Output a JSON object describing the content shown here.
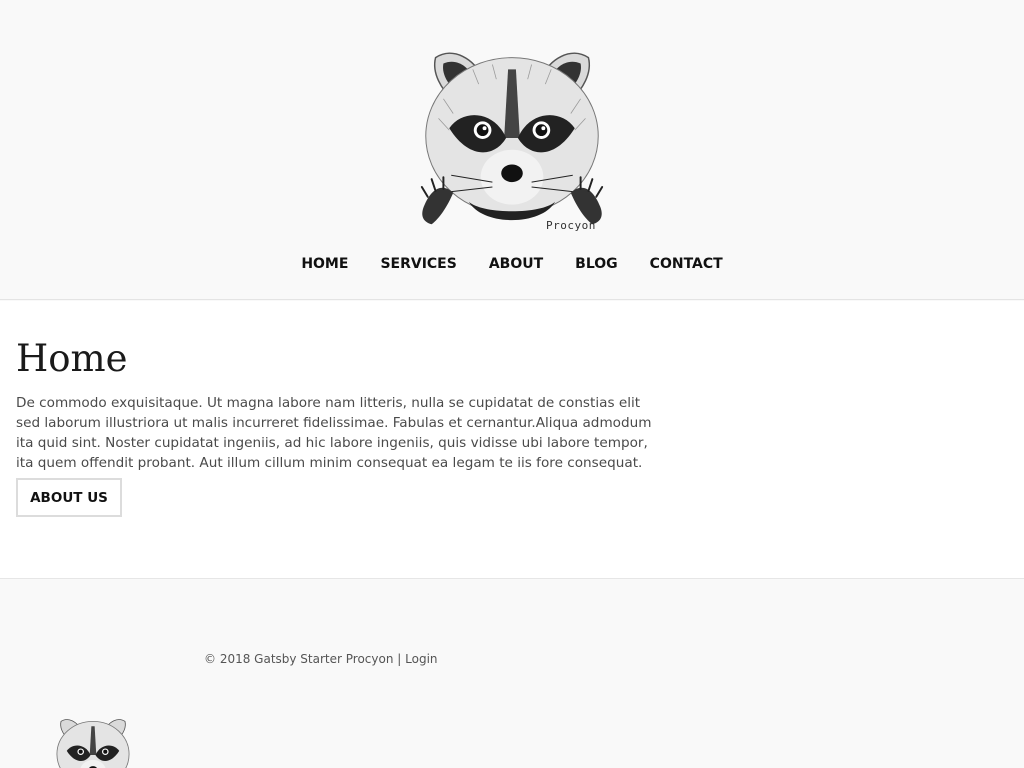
{
  "header": {
    "logo_caption": "Procyon",
    "logo_icon": "raccoon-logo"
  },
  "nav": {
    "items": [
      {
        "label": "HOME"
      },
      {
        "label": "SERVICES"
      },
      {
        "label": "ABOUT"
      },
      {
        "label": "BLOG"
      },
      {
        "label": "CONTACT"
      }
    ]
  },
  "main": {
    "title": "Home",
    "intro": "De commodo exquisitaque. Ut magna labore nam litteris, nulla se cupidatat de constias elit sed laborum illustriora ut malis incurreret fidelissimae. Fabulas et cernantur.Aliqua admodum ita quid sint. Noster cupidatat ingeniis, ad hic labore ingeniis, quis vidisse ubi labore tempor, ita quem offendit probant. Aut illum cillum minim consequat ea legam te iis fore consequat.",
    "about_button": "ABOUT US"
  },
  "footer": {
    "copyright": "© 2018 Gatsby Starter Procyon",
    "separator": "|",
    "login": "Login",
    "logo_icon": "raccoon-logo"
  },
  "colors": {
    "background": "#f9f9f9",
    "main_background": "#ffffff",
    "text": "#222222",
    "muted_text": "#4a4a4a"
  }
}
